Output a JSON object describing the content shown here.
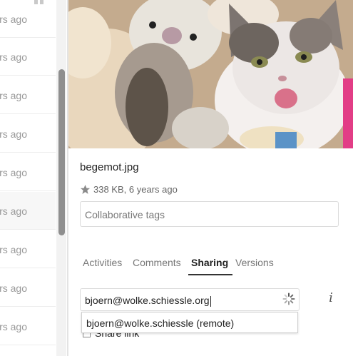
{
  "file_list": {
    "rows": [
      {
        "mtime": "rs ago"
      },
      {
        "mtime": "rs ago"
      },
      {
        "mtime": "rs ago"
      },
      {
        "mtime": "rs ago"
      },
      {
        "mtime": "rs ago"
      },
      {
        "mtime": "rs ago",
        "selected": true
      },
      {
        "mtime": "rs ago"
      },
      {
        "mtime": "rs ago"
      },
      {
        "mtime": "rs ago"
      }
    ]
  },
  "sidebar": {
    "filename": "begemot.jpg",
    "meta": "338 KB, 6 years ago",
    "tags_placeholder": "Collaborative tags",
    "tabs": [
      {
        "label": "Activities"
      },
      {
        "label": "Comments"
      },
      {
        "label": "Sharing",
        "active": true
      },
      {
        "label": "Versions"
      }
    ],
    "share": {
      "input_value": "bjoern@wolke.schiessle.org",
      "suggestion": "bjoern@wolke.schiessle (remote)",
      "info_label": "i",
      "share_link_label": "Share link"
    }
  },
  "colors": {
    "accent": "#333333",
    "muted_text": "#999999",
    "border": "#dbdbdb"
  },
  "icons": {
    "favorite": "star-icon",
    "loading": "spinner-icon",
    "info": "info-icon"
  }
}
